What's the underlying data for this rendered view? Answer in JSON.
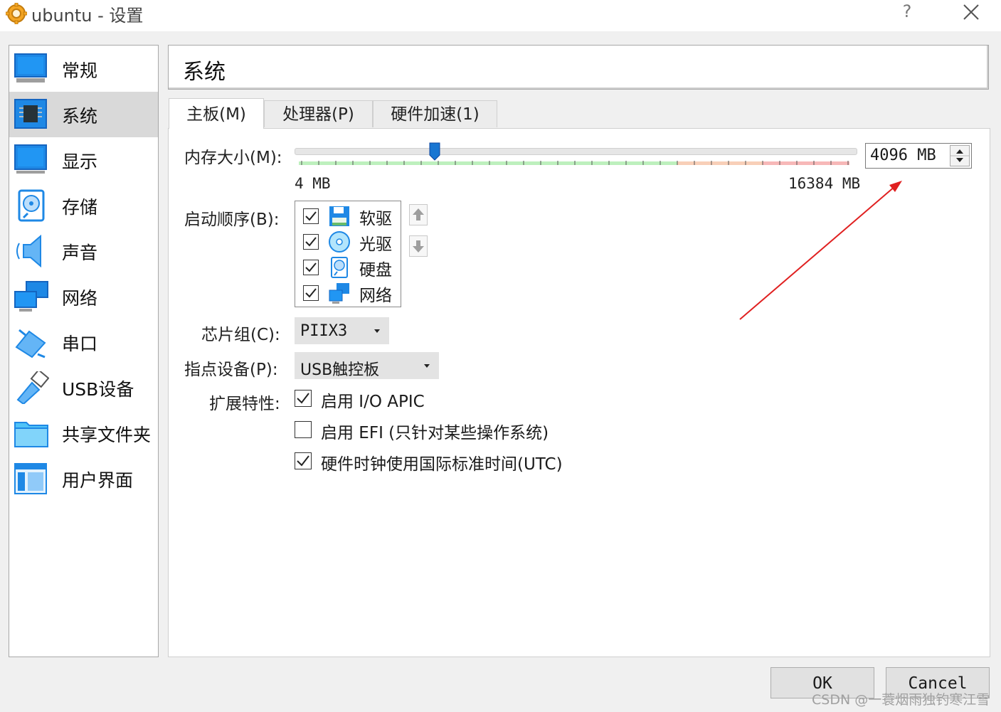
{
  "window": {
    "title": "ubuntu - 设置",
    "help": "?"
  },
  "sidebar": {
    "items": [
      {
        "label": "常规",
        "icon": "monitor-icon",
        "selected": false
      },
      {
        "label": "系统",
        "icon": "chip-icon",
        "selected": true
      },
      {
        "label": "显示",
        "icon": "display-icon",
        "selected": false
      },
      {
        "label": "存储",
        "icon": "storage-disk-icon",
        "selected": false
      },
      {
        "label": "声音",
        "icon": "speaker-icon",
        "selected": false
      },
      {
        "label": "网络",
        "icon": "network-icon",
        "selected": false
      },
      {
        "label": "串口",
        "icon": "serial-port-icon",
        "selected": false
      },
      {
        "label": "USB设备",
        "icon": "usb-icon",
        "selected": false
      },
      {
        "label": "共享文件夹",
        "icon": "folder-icon",
        "selected": false
      },
      {
        "label": "用户界面",
        "icon": "ui-window-icon",
        "selected": false
      }
    ]
  },
  "header": {
    "title": "系统"
  },
  "tabs": [
    {
      "label": "主板(M)",
      "active": true
    },
    {
      "label": "处理器(P)",
      "active": false
    },
    {
      "label": "硬件加速(1)",
      "active": false
    }
  ],
  "motherboard": {
    "memory_label": "内存大小(M):",
    "memory_min": "4 MB",
    "memory_max": "16384 MB",
    "memory_value": "4096 MB",
    "memory_fraction": 0.25,
    "boot_label": "启动顺序(B):",
    "boot_items": [
      {
        "label": "软驱",
        "checked": true,
        "icon": "floppy-icon"
      },
      {
        "label": "光驱",
        "checked": true,
        "icon": "optical-disc-icon"
      },
      {
        "label": "硬盘",
        "checked": true,
        "icon": "hard-disk-icon"
      },
      {
        "label": "网络",
        "checked": true,
        "icon": "network-icon"
      }
    ],
    "chipset_label": "芯片组(C):",
    "chipset_value": "PIIX3",
    "pointing_label": "指点设备(P):",
    "pointing_value": "USB触控板",
    "features_label": "扩展特性:",
    "features": [
      {
        "label": "启用 I/O APIC",
        "checked": true
      },
      {
        "label": "启用 EFI (只针对某些操作系统)",
        "checked": false
      },
      {
        "label": "硬件时钟使用国际标准时间(UTC)",
        "checked": true
      }
    ]
  },
  "buttons": {
    "ok": "OK",
    "cancel": "Cancel"
  },
  "watermark": "CSDN @一蓑烟雨独钓寒江雪",
  "colors": {
    "accent": "#1e88e5",
    "annotation": "#e02020",
    "selection": "#d9d9d9"
  }
}
